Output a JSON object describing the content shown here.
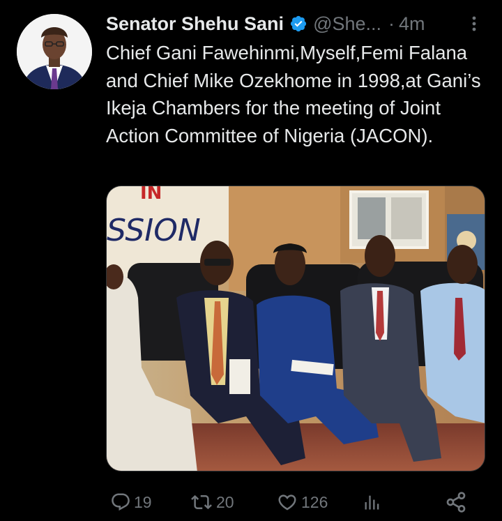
{
  "tweet": {
    "author": {
      "display_name": "Senator Shehu Sani",
      "handle": "@She...",
      "verified": true
    },
    "separator": "·",
    "time": "4m",
    "text": "Chief Gani Fawehinmi,Myself,Femi Falana and Chief Mike Ozekhome in 1998,at Gani’s Ikeja Chambers for the meeting of Joint Action Committee of Nigeria (JACON).",
    "media": {
      "banner_text": "SSION",
      "banner_text_top": "IN"
    },
    "actions": {
      "replies": "19",
      "retweets": "20",
      "likes": "126"
    }
  },
  "colors": {
    "background": "#000000",
    "text_primary": "#e7e9ea",
    "text_secondary": "#71767b",
    "verified_blue": "#1d9bf0"
  },
  "icons": {
    "reply": "reply-icon",
    "retweet": "retweet-icon",
    "like": "heart-icon",
    "views": "views-icon",
    "share": "share-icon",
    "more": "more-vertical-icon",
    "verified": "verified-badge-icon"
  }
}
